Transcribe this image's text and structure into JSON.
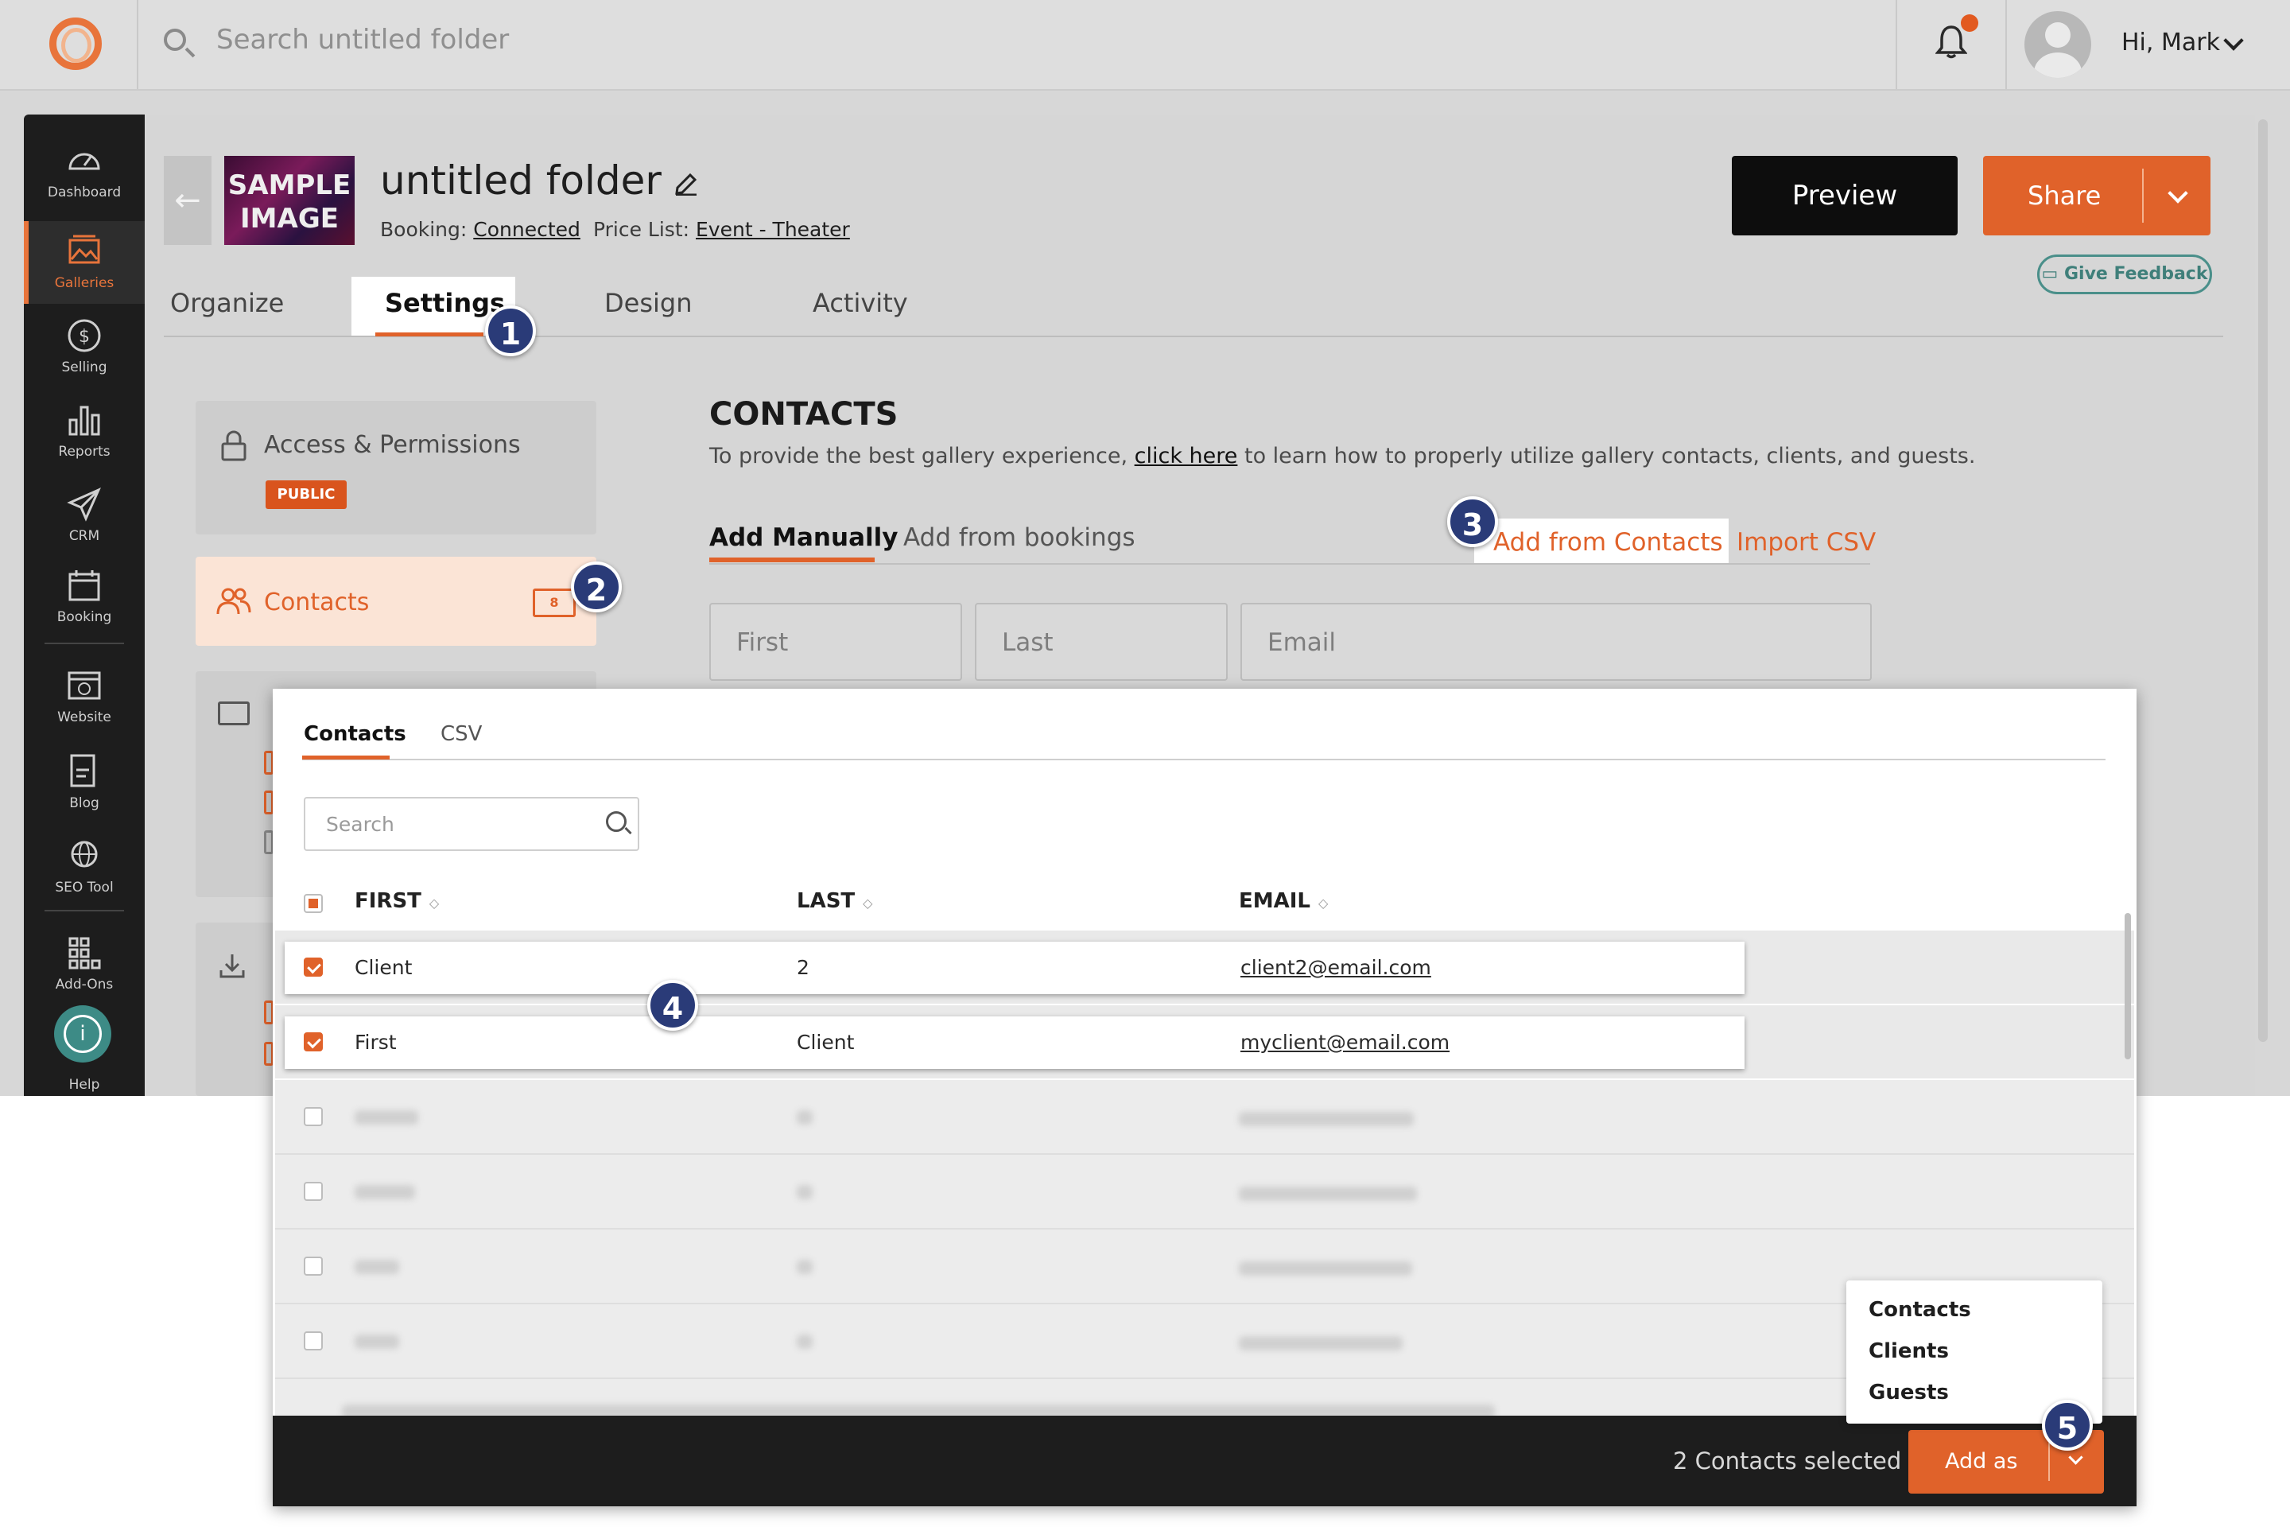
{
  "topbar": {
    "search_placeholder": "Search untitled folder",
    "greeting": "Hi, Mark"
  },
  "sidebar": {
    "items": [
      {
        "label": "Dashboard",
        "icon": "gauge-icon"
      },
      {
        "label": "Galleries",
        "icon": "image-icon"
      },
      {
        "label": "Selling",
        "icon": "dollar-icon"
      },
      {
        "label": "Reports",
        "icon": "bar-chart-icon"
      },
      {
        "label": "CRM",
        "icon": "send-icon"
      },
      {
        "label": "Booking",
        "icon": "calendar-icon"
      },
      {
        "label": "Website",
        "icon": "website-icon"
      },
      {
        "label": "Blog",
        "icon": "blog-icon"
      },
      {
        "label": "SEO Tool",
        "icon": "globe-search-icon"
      },
      {
        "label": "Add-Ons",
        "icon": "grid-plus-icon"
      },
      {
        "label": "Help",
        "icon": "help-icon"
      }
    ],
    "active": "Galleries"
  },
  "header": {
    "thumb_text": "SAMPLE IMAGE",
    "title": "untitled folder",
    "booking_label": "Booking:",
    "booking_value": "Connected",
    "pricelist_label": "Price List:",
    "pricelist_value": "Event - Theater",
    "preview_label": "Preview",
    "share_label": "Share",
    "feedback_label": "Give Feedback"
  },
  "tabs": [
    "Organize",
    "Settings",
    "Design",
    "Activity"
  ],
  "settings_nav": {
    "access_label": "Access & Permissions",
    "access_badge": "PUBLIC",
    "contacts_label": "Contacts",
    "contacts_count": "8"
  },
  "contacts_section": {
    "heading": "CONTACTS",
    "desc_before": "To provide the best gallery experience, ",
    "desc_link": "click here",
    "desc_after": " to learn how to properly utilize gallery contacts, clients, and guests.",
    "subtabs": [
      "Add Manually",
      "Add from bookings"
    ],
    "add_from_contacts": "Add from Contacts",
    "import_csv": "Import CSV",
    "field_first": "First",
    "field_last": "Last",
    "field_email": "Email"
  },
  "modal": {
    "tabs": [
      "Contacts",
      "CSV"
    ],
    "search_placeholder": "Search",
    "columns": [
      "FIRST",
      "LAST",
      "EMAIL"
    ],
    "rows": [
      {
        "first": "Client",
        "last": "2",
        "email": "client2@email.com",
        "checked": true
      },
      {
        "first": "First",
        "last": "Client",
        "email": "myclient@email.com",
        "checked": true
      }
    ],
    "selected_text": "2 Contacts selected",
    "add_as_label": "Add as",
    "dropdown_options": [
      "Contacts",
      "Clients",
      "Guests"
    ]
  },
  "steps": [
    "1",
    "2",
    "3",
    "4",
    "5"
  ],
  "colors": {
    "accent": "#e0622a",
    "sidebar_bg": "#1d1d1d",
    "step_marker": "#2a3b78",
    "feedback": "#3f7f7a"
  }
}
